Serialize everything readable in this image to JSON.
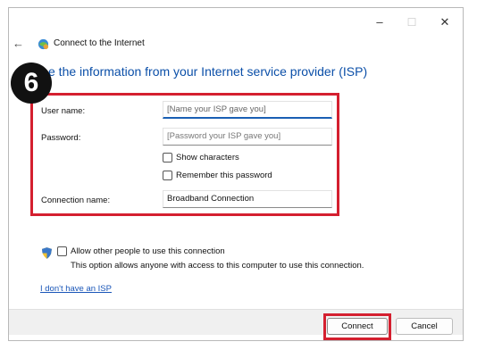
{
  "window": {
    "controls": {
      "minimize": "–",
      "maximize": "☐",
      "close": "✕"
    },
    "back_icon": "arrow-left-icon",
    "nav_icon": "network-globe-icon",
    "nav_title": "Connect to the Internet"
  },
  "step_badge": "6",
  "heading": "e the information from your Internet service provider (ISP)",
  "form": {
    "username_label": "User name:",
    "username_placeholder": "[Name your ISP gave you]",
    "password_label": "Password:",
    "password_placeholder": "[Password your ISP gave you]",
    "show_characters": "Show characters",
    "remember_password": "Remember this password",
    "connection_name_label": "Connection name:",
    "connection_name_value": "Broadband Connection"
  },
  "sharing": {
    "icon": "uac-shield-icon",
    "allow_label": "Allow other people to use this connection",
    "note": "This option allows anyone with access to this computer to use this connection."
  },
  "no_isp_link": "I don't have an ISP",
  "buttons": {
    "connect": "Connect",
    "cancel": "Cancel"
  },
  "colors": {
    "highlight": "#d41f2f",
    "heading": "#0b4fa8",
    "link": "#1a56b8"
  }
}
